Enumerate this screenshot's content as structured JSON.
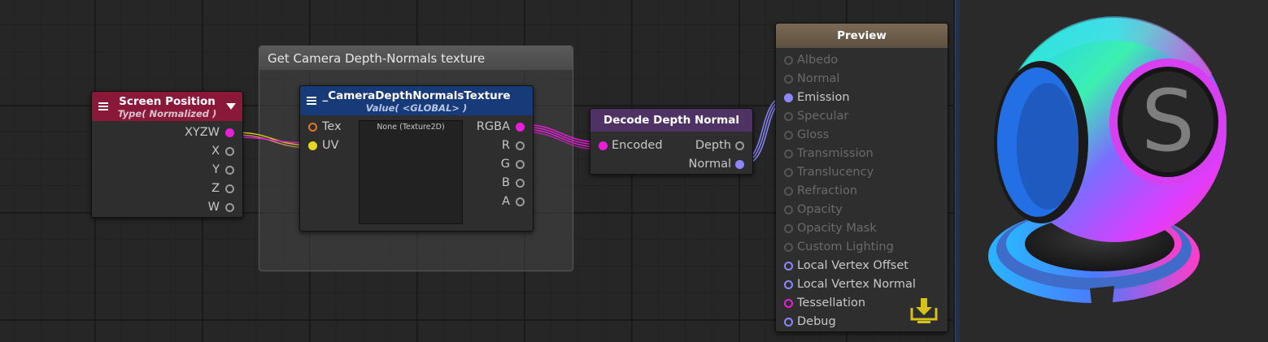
{
  "group": {
    "title": "Get Camera Depth-Normals texture"
  },
  "screen_position_node": {
    "title": "Screen Position",
    "subtitle": "Type( Normalized )",
    "outputs": [
      "XYZW",
      "X",
      "Y",
      "Z",
      "W"
    ],
    "header_color": "#8a1838"
  },
  "texture_node": {
    "title": "_CameraDepthNormalsTexture",
    "subtitle": "Value( <GLOBAL> )",
    "inputs": [
      "Tex",
      "UV"
    ],
    "outputs": [
      "RGBA",
      "R",
      "G",
      "B",
      "A"
    ],
    "texture_label": "None (Texture2D)",
    "header_color": "#173a78"
  },
  "decode_node": {
    "title": "Decode Depth Normal",
    "input": "Encoded",
    "outputs": [
      "Depth",
      "Normal"
    ],
    "header_color": "#4d3263"
  },
  "preview_node": {
    "title": "Preview",
    "header_color": "#6b5c49",
    "inputs": [
      {
        "label": "Albedo",
        "state": "inactive"
      },
      {
        "label": "Normal",
        "state": "inactive"
      },
      {
        "label": "Emission",
        "state": "connected"
      },
      {
        "label": "Specular",
        "state": "inactive"
      },
      {
        "label": "Gloss",
        "state": "inactive"
      },
      {
        "label": "Transmission",
        "state": "inactive"
      },
      {
        "label": "Translucency",
        "state": "inactive"
      },
      {
        "label": "Refraction",
        "state": "inactive"
      },
      {
        "label": "Opacity",
        "state": "inactive"
      },
      {
        "label": "Opacity Mask",
        "state": "inactive"
      },
      {
        "label": "Custom Lighting",
        "state": "inactive"
      },
      {
        "label": "Local Vertex Offset",
        "state": "active"
      },
      {
        "label": "Local Vertex Normal",
        "state": "active"
      },
      {
        "label": "Tessellation",
        "state": "active-magenta"
      },
      {
        "label": "Debug",
        "state": "active"
      }
    ]
  },
  "colors": {
    "wire_magenta": "#e81ed9",
    "wire_yellow": "#e8d51e",
    "wire_blue": "#8c86ff",
    "save_icon": "#d4c21a"
  },
  "icons": {
    "menu": "hamburger-menu-icon",
    "dropdown": "dropdown-arrow-icon",
    "save": "download-save-icon",
    "preview": "material-preview-sphere"
  }
}
